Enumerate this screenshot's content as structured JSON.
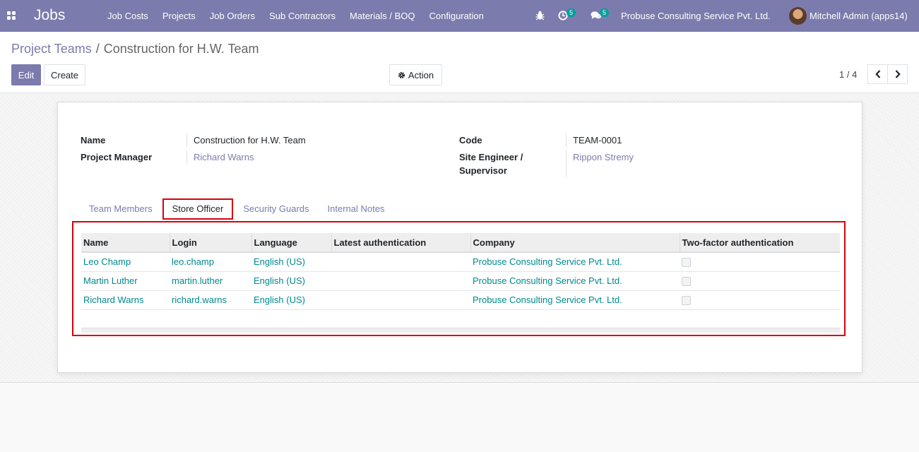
{
  "app": {
    "brand": "Jobs"
  },
  "menu": [
    "Job Costs",
    "Projects",
    "Job Orders",
    "Sub Contractors",
    "Materials / BOQ",
    "Configuration"
  ],
  "systray": {
    "activity_count": "5",
    "message_count": "5",
    "company": "Probuse Consulting Service Pvt. Ltd.",
    "user": "Mitchell Admin (apps14)"
  },
  "breadcrumb": {
    "parent": "Project Teams",
    "separator": "/",
    "current": "Construction for H.W. Team"
  },
  "buttons": {
    "edit": "Edit",
    "create": "Create",
    "action": "Action"
  },
  "pager": {
    "value": "1 / 4"
  },
  "form": {
    "name_label": "Name",
    "name_value": "Construction for H.W. Team",
    "pm_label": "Project Manager",
    "pm_value": "Richard Warns",
    "code_label": "Code",
    "code_value": "TEAM-0001",
    "se_label_1": "Site Engineer /",
    "se_label_2": "Supervisor",
    "se_value": "Rippon Stremy"
  },
  "tabs": [
    "Team Members",
    "Store Officer",
    "Security Guards",
    "Internal Notes"
  ],
  "active_tab": "Store Officer",
  "table": {
    "columns": [
      "Name",
      "Login",
      "Language",
      "Latest authentication",
      "Company",
      "Two-factor authentication"
    ],
    "rows": [
      {
        "name": "Leo Champ",
        "login": "leo.champ",
        "language": "English (US)",
        "latest": "",
        "company": "Probuse Consulting Service Pvt. Ltd."
      },
      {
        "name": "Martin Luther",
        "login": "martin.luther",
        "language": "English (US)",
        "latest": "",
        "company": "Probuse Consulting Service Pvt. Ltd."
      },
      {
        "name": "Richard Warns",
        "login": "richard.warns",
        "language": "English (US)",
        "latest": "",
        "company": "Probuse Consulting Service Pvt. Ltd."
      }
    ]
  },
  "colors": {
    "brand": "#7c7bad",
    "link": "#00898e",
    "highlight": "#d9000d"
  },
  "icons": [
    "apps-icon",
    "bug-icon",
    "clock-icon",
    "chat-icon",
    "gear-icon",
    "chevron-left-icon",
    "chevron-right-icon"
  ]
}
